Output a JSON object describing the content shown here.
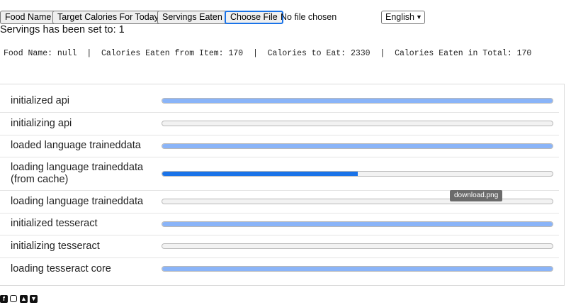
{
  "toolbar": {
    "food_name_label": "Food Name",
    "target_calories_label": "Target Calories For Today",
    "servings_eaten_label": "Servings Eaten",
    "choose_file_label": "Choose File",
    "no_file_text": "No file chosen",
    "language_selected": "English"
  },
  "servings_message": "Servings has been set to: 1",
  "stats_line": "Food Name: null  |  Calories Eaten from Item: 170  |  Calories to Eat: 2330  |  Calories Eaten in Total: 170",
  "progress_rows": [
    {
      "label": "initialized api",
      "progress": 1.0,
      "color": "#8ab4f8"
    },
    {
      "label": "initializing api",
      "progress": 0.0,
      "color": "#8ab4f8"
    },
    {
      "label": "loaded language traineddata",
      "progress": 1.0,
      "color": "#8ab4f8"
    },
    {
      "label": "loading language traineddata\n(from cache)",
      "progress": 0.5,
      "color": "#1a73e8"
    },
    {
      "label": "loading language traineddata",
      "progress": 0.0,
      "color": "#8ab4f8"
    },
    {
      "label": "initialized tesseract",
      "progress": 1.0,
      "color": "#8ab4f8"
    },
    {
      "label": "initializing tesseract",
      "progress": 0.0,
      "color": "#8ab4f8"
    },
    {
      "label": "loading tesseract core",
      "progress": 1.0,
      "color": "#8ab4f8"
    }
  ],
  "tooltip_text": "download.png",
  "social_icons": [
    "facebook-icon",
    "instagram-icon",
    "snapchat-icon",
    "twitter-icon"
  ]
}
